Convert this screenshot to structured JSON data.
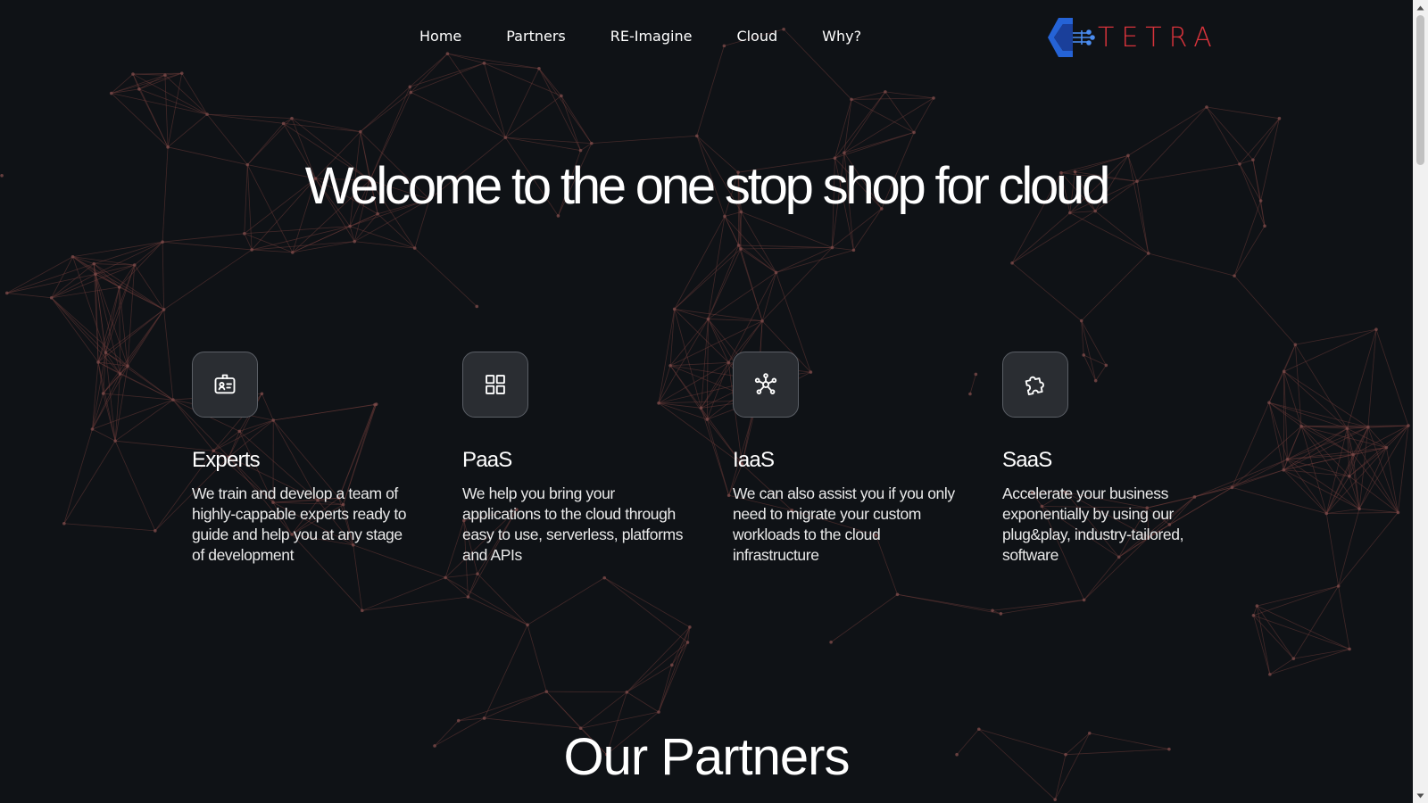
{
  "nav": {
    "links": [
      "Home",
      "Partners",
      "RE-Imagine",
      "Cloud",
      "Why?"
    ],
    "logo_text": "TETRA",
    "logo_color": "#d8333b",
    "logo_mark_color": "#2563d6"
  },
  "hero": {
    "title": "Welcome to the one stop shop for cloud"
  },
  "features": [
    {
      "icon": "id-badge-icon",
      "title": "Experts",
      "description": "We train and develop a team of highly-cappable experts ready to guide and help you at any stage of development"
    },
    {
      "icon": "grid-icon",
      "title": "PaaS",
      "description": "We help you bring your applications to the cloud through easy to use, serverless, platforms and APIs"
    },
    {
      "icon": "network-icon",
      "title": "IaaS",
      "description": "We can also assist you if you only need to migrate your custom workloads to the cloud infrastructure"
    },
    {
      "icon": "puzzle-icon",
      "title": "SaaS",
      "description": "Accelerate your business exponentially by using our plug&play, industry-tailored, software"
    }
  ],
  "partners": {
    "title": "Our Partners"
  },
  "colors": {
    "background": "#0f1216",
    "network_lines": "#6b3a38",
    "icon_box": "#2a2d32"
  }
}
